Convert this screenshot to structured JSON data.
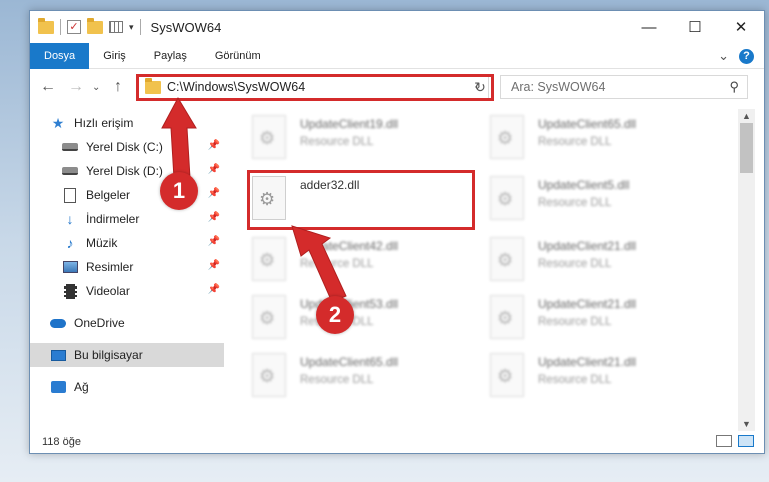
{
  "window": {
    "title": "SysWOW64",
    "controls": [
      "—",
      "☐",
      "✕"
    ]
  },
  "ribbon": {
    "tabs": [
      "Dosya",
      "Giriş",
      "Paylaş",
      "Görünüm"
    ],
    "active_tab": "Dosya",
    "help": "?",
    "expand": "⌄"
  },
  "address": {
    "path": "C:\\Windows\\SysWOW64",
    "search_placeholder": "Ara: SysWOW64"
  },
  "nav": {
    "quick_access": "Hızlı erişim",
    "items": [
      {
        "label": "Yerel Disk (C:)",
        "icon": "disk-icon",
        "pinned": true
      },
      {
        "label": "Yerel Disk (D:)",
        "icon": "disk-icon",
        "pinned": true
      },
      {
        "label": "Belgeler",
        "icon": "document-icon",
        "pinned": true
      },
      {
        "label": "İndirmeler",
        "icon": "download-icon",
        "pinned": true
      },
      {
        "label": "Müzik",
        "icon": "music-icon",
        "pinned": true
      },
      {
        "label": "Resimler",
        "icon": "picture-icon",
        "pinned": true
      },
      {
        "label": "Videolar",
        "icon": "video-icon",
        "pinned": true
      }
    ],
    "onedrive": "OneDrive",
    "this_pc": "Bu bilgisayar",
    "network": "Ağ"
  },
  "files": {
    "highlighted": {
      "name": "adder32.dll",
      "type": ""
    },
    "left_column": [
      {
        "name": "UpdateClient19.dll",
        "type": "Resource DLL"
      },
      {
        "name": "UpdateClient42.dll",
        "type": "Resource DLL"
      },
      {
        "name": "UpdateClient53.dll",
        "type": "Resource DLL"
      },
      {
        "name": "UpdateClient65.dll",
        "type": "Resource DLL"
      }
    ],
    "right_column": [
      {
        "name": "UpdateClient65.dll",
        "type": "Resource DLL"
      },
      {
        "name": "UpdateClient5.dll",
        "type": "Resource DLL"
      },
      {
        "name": "UpdateClient21.dll",
        "type": "Resource DLL"
      },
      {
        "name": "UpdateClient21.dll",
        "type": "Resource DLL"
      },
      {
        "name": "UpdateClient21.dll",
        "type": "Resource DLL"
      }
    ]
  },
  "status": {
    "item_count": "118 öğe"
  },
  "annotations": {
    "step1": "1",
    "step2": "2",
    "color": "#d42b2b"
  }
}
